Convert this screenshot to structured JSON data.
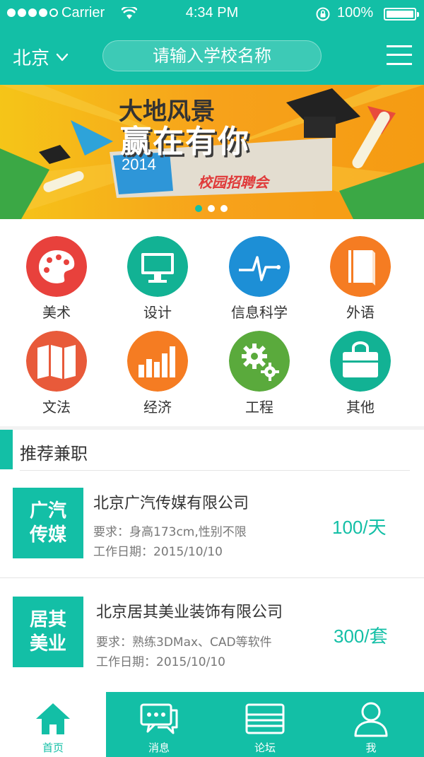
{
  "status_bar": {
    "carrier": "Carrier",
    "time": "4:34 PM",
    "battery_percent": "100%",
    "signal_bars": 4,
    "signal_total": 5
  },
  "header": {
    "city": "北京",
    "search_placeholder": "请输入学校名称"
  },
  "banner": {
    "title_line1": "大地风景",
    "title_line2": "赢在有你",
    "year": "2014",
    "subtitle": "校园招聘会",
    "slide_count": 3,
    "active_slide": 1
  },
  "categories": [
    {
      "label": "美术",
      "icon": "palette-icon",
      "color": "#e8413c"
    },
    {
      "label": "设计",
      "icon": "monitor-icon",
      "color": "#12b294"
    },
    {
      "label": "信息科学",
      "icon": "pulse-icon",
      "color": "#1d8fd6"
    },
    {
      "label": "外语",
      "icon": "book-icon",
      "color": "#f57c22"
    },
    {
      "label": "文法",
      "icon": "map-icon",
      "color": "#e85a3a"
    },
    {
      "label": "经济",
      "icon": "bar-chart-icon",
      "color": "#f57c22"
    },
    {
      "label": "工程",
      "icon": "gears-icon",
      "color": "#5aaa3c"
    },
    {
      "label": "其他",
      "icon": "bag-icon",
      "color": "#12b294"
    }
  ],
  "recommend": {
    "title": "推荐兼职",
    "jobs": [
      {
        "logo_line1": "广汽",
        "logo_line2": "传媒",
        "name": "北京广汽传媒有限公司",
        "requirement": "要求：身高173cm,性别不限",
        "date": "工作日期：2015/10/10",
        "price": "100/天"
      },
      {
        "logo_line1": "居其",
        "logo_line2": "美业",
        "name": "北京居其美业装饰有限公司",
        "requirement": "要求：熟练3DMax、CAD等软件",
        "date": "工作日期：2015/10/10",
        "price": "300/套"
      }
    ]
  },
  "tabbar": {
    "tabs": [
      {
        "label": "首页",
        "icon": "home-icon",
        "active": true
      },
      {
        "label": "消息",
        "icon": "chat-icon",
        "active": false
      },
      {
        "label": "论坛",
        "icon": "forum-icon",
        "active": false
      },
      {
        "label": "我",
        "icon": "user-icon",
        "active": false
      }
    ]
  },
  "colors": {
    "brand": "#13bfa6",
    "banner_bg": "#f7a21b"
  }
}
